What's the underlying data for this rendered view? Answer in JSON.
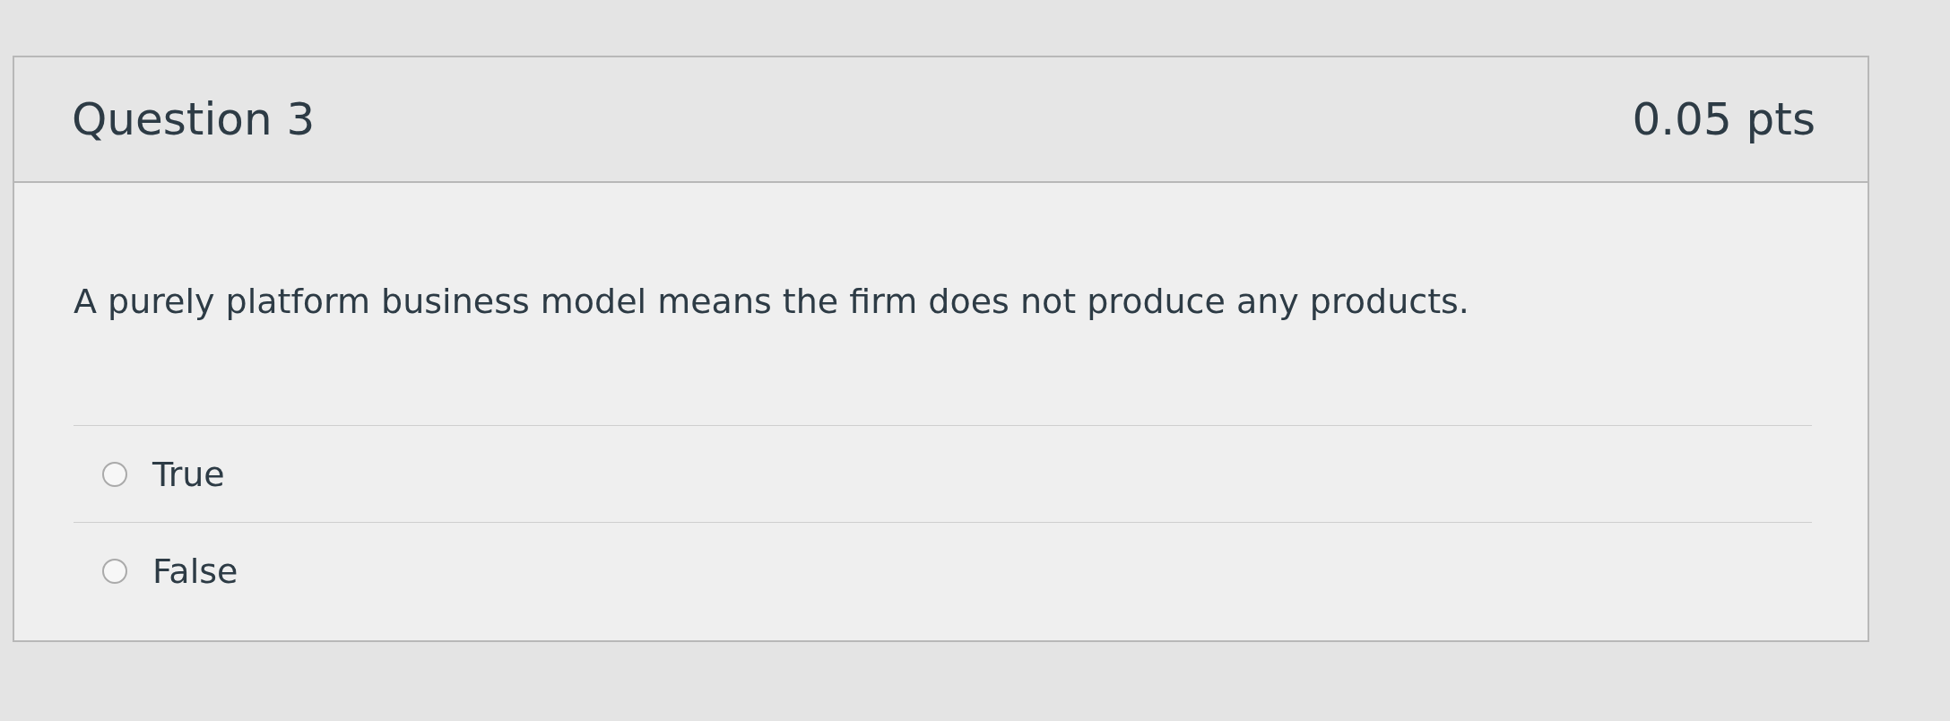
{
  "question": {
    "title": "Question 3",
    "points": "0.05 pts",
    "text": "A purely platform business model means the ﬁrm does not produce any products."
  },
  "answers": [
    {
      "label": "True",
      "selected": false
    },
    {
      "label": "False",
      "selected": false
    }
  ]
}
